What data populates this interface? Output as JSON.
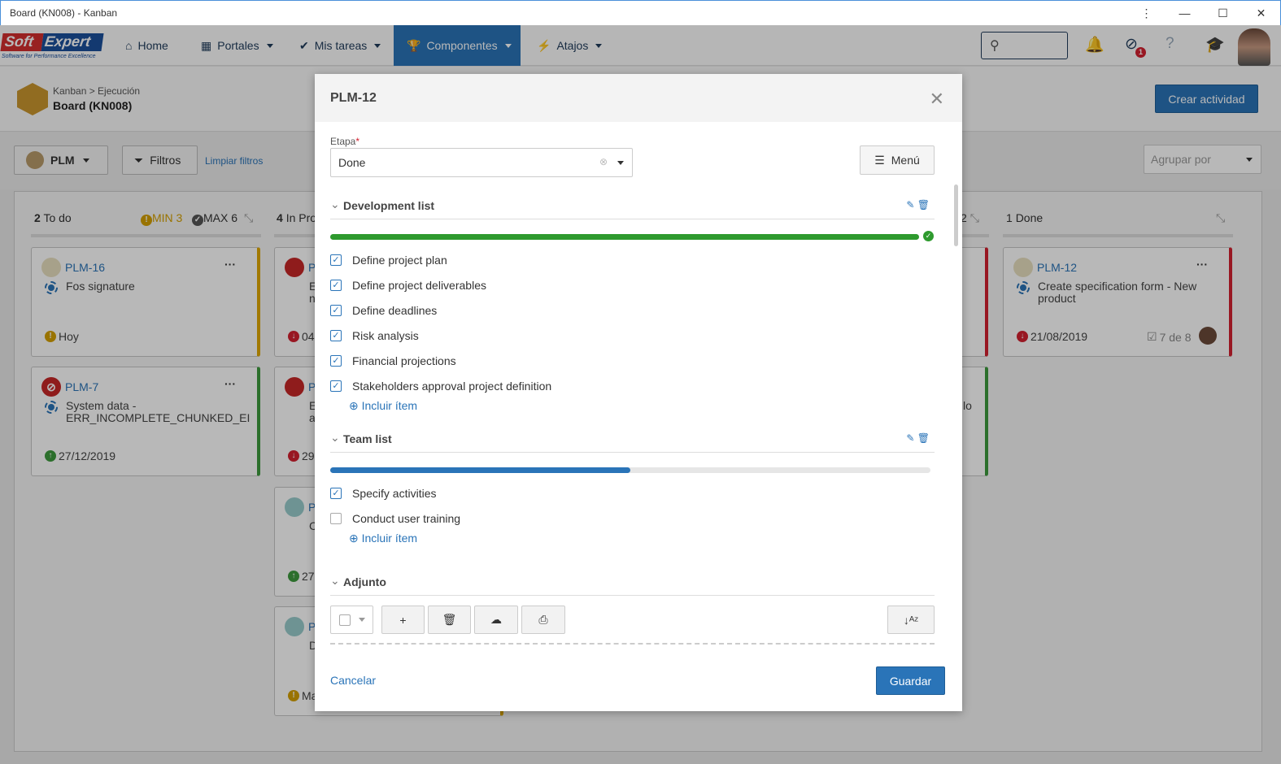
{
  "window": {
    "title": "Board (KN008) - Kanban",
    "controls": [
      "⋮",
      "—",
      "☐",
      "✕"
    ]
  },
  "nav": {
    "logo_text1": "Soft",
    "logo_text2": "Expert",
    "logo_tagline": "Software for Performance Excellence",
    "items": [
      {
        "label": "Home",
        "icon": "home-icon"
      },
      {
        "label": "Portales",
        "icon": "grid-icon"
      },
      {
        "label": "Mis tareas",
        "icon": "check-icon"
      },
      {
        "label": "Componentes",
        "icon": "trophy-icon",
        "active": true
      },
      {
        "label": "Atajos",
        "icon": "bolt-icon"
      }
    ],
    "notification_badge": "1"
  },
  "header": {
    "breadcrumb": "Kanban > Ejecución",
    "title": "Board (KN008)",
    "create_button": "Crear actividad"
  },
  "toolbar": {
    "board_select": "PLM",
    "filters": "Filtros",
    "clear_filters": "Limpiar filtros",
    "group_by_placeholder": "Agrupar por"
  },
  "columns": [
    {
      "count": "2",
      "name": "To do",
      "min": "MIN 3",
      "max": "MAX 6",
      "cards": [
        {
          "id": "PLM-16",
          "title": "Fos signature",
          "due": "Hoy",
          "due_status": "warning",
          "accent": "#e0a800"
        },
        {
          "id": "PLM-7",
          "title": "System data -\nERR_INCOMPLETE_CHUNKED_EI",
          "due": "27/12/2019",
          "due_status": "ok",
          "accent": "#3d9a3d"
        }
      ]
    },
    {
      "count": "4",
      "name": "In Pro",
      "cards": [
        {
          "id": "P",
          "title": "E\nn",
          "due": "04",
          "accent": "#e0a800"
        },
        {
          "id": "P",
          "title": "E\na",
          "due": "29",
          "accent": "#e0a800"
        },
        {
          "id": "P",
          "title": "C",
          "due": "27",
          "accent": "#e0a800"
        },
        {
          "id": "P",
          "title": "D",
          "due": "Ma",
          "accent": "#e0a800"
        }
      ]
    },
    {
      "count": "2",
      "name": "",
      "cards": [
        {
          "title": "",
          "accent": "#d32030"
        },
        {
          "title": "lo",
          "accent": "#3d9a3d"
        }
      ]
    },
    {
      "count": "1",
      "name": "Done",
      "cards": [
        {
          "id": "PLM-12",
          "title": "Create specification form - New product",
          "due": "21/08/2019",
          "due_status": "late",
          "checklist": "7 de 8",
          "accent": "#d32030"
        }
      ]
    }
  ],
  "modal": {
    "title": "PLM-12",
    "stage_label": "Etapa",
    "stage_value": "Done",
    "menu": "Menú",
    "checklists": [
      {
        "name": "Development list",
        "progress": 100,
        "color": "#2e9a2e",
        "items": [
          {
            "label": "Define project plan",
            "checked": true
          },
          {
            "label": "Define project deliverables",
            "checked": true
          },
          {
            "label": "Define deadlines",
            "checked": true
          },
          {
            "label": "Risk analysis",
            "checked": true
          },
          {
            "label": "Financial projections",
            "checked": true
          },
          {
            "label": "Stakeholders approval project definition",
            "checked": true
          }
        ]
      },
      {
        "name": "Team list",
        "progress": 50,
        "color": "#2a74b8",
        "items": [
          {
            "label": "Specify activities",
            "checked": true
          },
          {
            "label": "Conduct user training",
            "checked": false
          }
        ]
      }
    ],
    "add_item": "Incluir ítem",
    "attachments": "Adjunto",
    "cancel": "Cancelar",
    "save": "Guardar"
  }
}
